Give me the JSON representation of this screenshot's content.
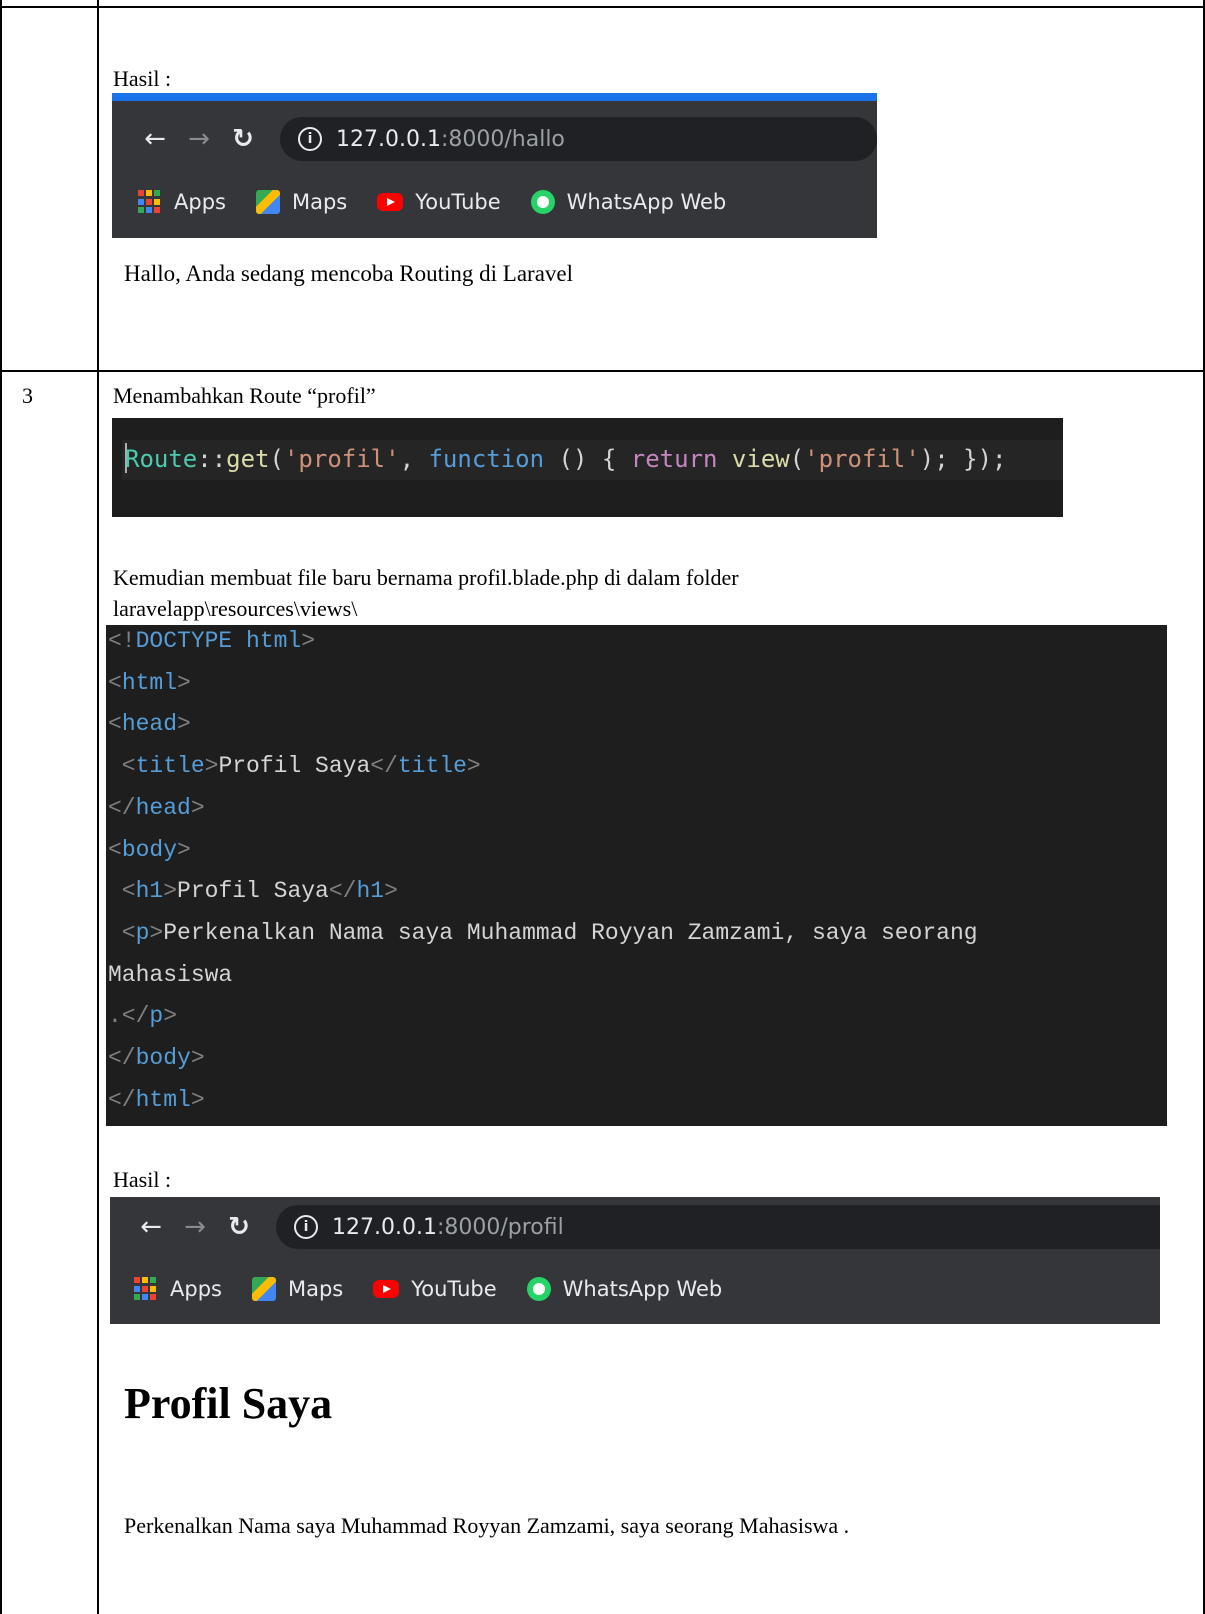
{
  "section_prev": {
    "result_label": "Hasil :",
    "browser": {
      "url_host": "127.0.0.1",
      "url_rest": ":8000/hallo",
      "bookmarks": [
        "Apps",
        "Maps",
        "YouTube",
        "WhatsApp Web"
      ]
    },
    "page_text": "Hallo, Anda sedang mencoba Routing di Laravel"
  },
  "section_3": {
    "number": "3",
    "heading": "Menambahkan Route “profil”",
    "route_code": {
      "cls": "Route",
      "op": "::",
      "fn": "get",
      "s1": "'profil'",
      "comma": ", ",
      "kw_function": "function",
      "paren": " () { ",
      "kw_return": "return",
      "sp": " ",
      "view": "view",
      "s2": "'profil'",
      "end": "); });"
    },
    "description_line1": "Kemudian membuat file baru bernama profil.blade.php di dalam folder",
    "description_line2": "laravelapp\\resources\\views\\",
    "html_code_lines": [
      {
        "open": "<!",
        "tag": "DOCTYPE html",
        "text": "",
        "close": ">"
      },
      {
        "open": "<",
        "tag": "html",
        "text": "",
        "close": ">"
      },
      {
        "open": "<",
        "tag": "head",
        "text": "",
        "close": ">"
      },
      {
        "open": " <",
        "tag": "title",
        "text": ">Profil Saya</",
        "tag2": "title",
        "close": ">"
      },
      {
        "open": "</",
        "tag": "head",
        "text": "",
        "close": ">"
      },
      {
        "open": "<",
        "tag": "body",
        "text": "",
        "close": ">"
      },
      {
        "open": " <",
        "tag": "h1",
        "text": ">Profil Saya</",
        "tag2": "h1",
        "close": ">"
      },
      {
        "open": " <",
        "tag": "p",
        "text": ">Perkenalkan Nama saya Muhammad Royyan Zamzami, saya seorang",
        "close": ""
      },
      {
        "open": "",
        "tag": "",
        "text": "Mahasiswa",
        "close": ""
      },
      {
        "open": ".</",
        "tag": "p",
        "text": "",
        "close": ">"
      },
      {
        "open": "</",
        "tag": "body",
        "text": "",
        "close": ">"
      },
      {
        "open": "</",
        "tag": "html",
        "text": "",
        "close": ">"
      }
    ],
    "result_label": "Hasil :",
    "browser": {
      "url_host": "127.0.0.1",
      "url_rest": ":8000/profil",
      "bookmarks": [
        "Apps",
        "Maps",
        "YouTube",
        "WhatsApp Web"
      ]
    },
    "page_heading": "Profil Saya",
    "page_paragraph": "Perkenalkan Nama saya Muhammad Royyan Zamzami, saya seorang Mahasiswa ."
  },
  "colors": {
    "chrome_dark": "#35363a",
    "omnibox": "#202124",
    "loading_bar": "#1a73e8",
    "code_bg": "#1e1e1e"
  }
}
